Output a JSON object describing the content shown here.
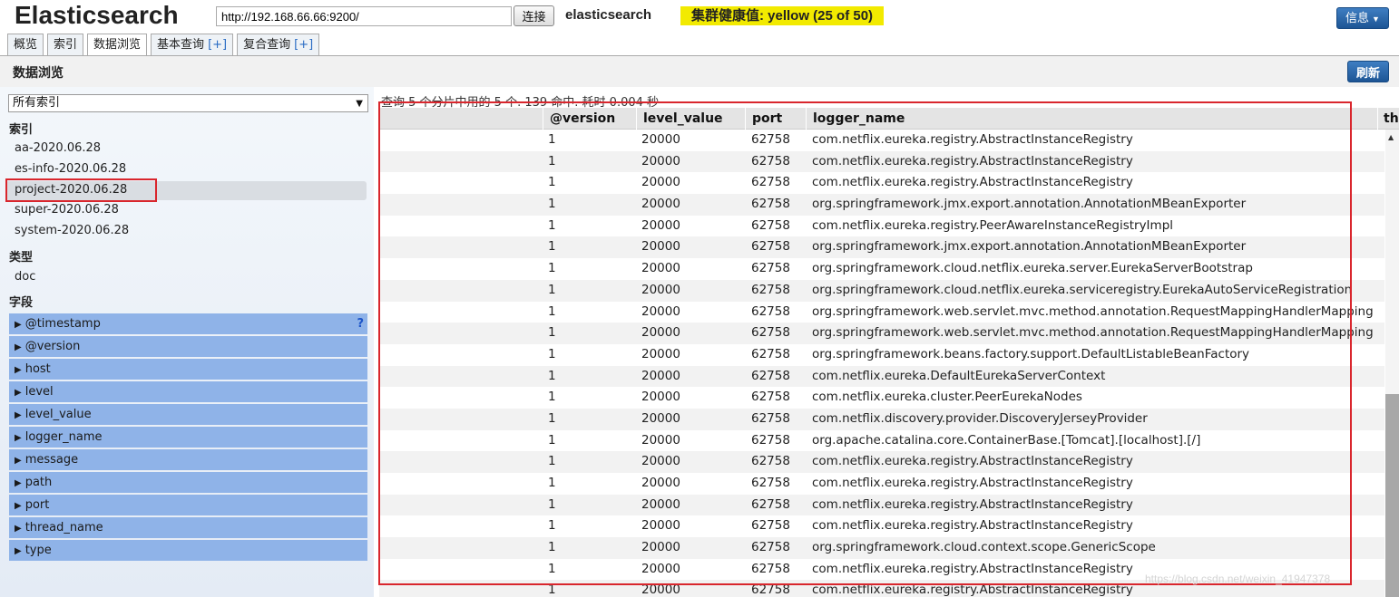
{
  "header": {
    "app_title": "Elasticsearch",
    "url_value": "http://192.168.66.66:9200/",
    "connect_label": "连接",
    "cluster_name": "elasticsearch",
    "health_text": "集群健康值: yellow (25 of 50)",
    "info_label": "信息"
  },
  "tabs": [
    {
      "label": "概览",
      "plus": ""
    },
    {
      "label": "索引",
      "plus": ""
    },
    {
      "label": "数据浏览",
      "plus": ""
    },
    {
      "label": "基本查询",
      "plus": "[+]"
    },
    {
      "label": "复合查询",
      "plus": "[+]"
    }
  ],
  "active_tab": "数据浏览",
  "section": {
    "title": "数据浏览",
    "refresh_label": "刷新"
  },
  "sidebar": {
    "index_select": "所有索引",
    "index_heading": "索引",
    "indices": [
      "aa-2020.06.28",
      "es-info-2020.06.28",
      "project-2020.06.28",
      "super-2020.06.28",
      "system-2020.06.28"
    ],
    "selected_index": "project-2020.06.28",
    "type_heading": "类型",
    "types": [
      "doc"
    ],
    "field_heading": "字段",
    "fields": [
      "@timestamp",
      "@version",
      "host",
      "level",
      "level_value",
      "logger_name",
      "message",
      "path",
      "port",
      "thread_name",
      "type"
    ],
    "help_icon": "?"
  },
  "results": {
    "summary": "查询 5 个分片中用的 5 个. 139 命中. 耗时 0.004 秒",
    "columns": [
      "@version",
      "level_value",
      "port",
      "logger_name",
      "th"
    ],
    "rows": [
      [
        "1",
        "20000",
        "62758",
        "com.netflix.eureka.registry.AbstractInstanceRegistry"
      ],
      [
        "1",
        "20000",
        "62758",
        "com.netflix.eureka.registry.AbstractInstanceRegistry"
      ],
      [
        "1",
        "20000",
        "62758",
        "com.netflix.eureka.registry.AbstractInstanceRegistry"
      ],
      [
        "1",
        "20000",
        "62758",
        "org.springframework.jmx.export.annotation.AnnotationMBeanExporter"
      ],
      [
        "1",
        "20000",
        "62758",
        "com.netflix.eureka.registry.PeerAwareInstanceRegistryImpl"
      ],
      [
        "1",
        "20000",
        "62758",
        "org.springframework.jmx.export.annotation.AnnotationMBeanExporter"
      ],
      [
        "1",
        "20000",
        "62758",
        "org.springframework.cloud.netflix.eureka.server.EurekaServerBootstrap"
      ],
      [
        "1",
        "20000",
        "62758",
        "org.springframework.cloud.netflix.eureka.serviceregistry.EurekaAutoServiceRegistration"
      ],
      [
        "1",
        "20000",
        "62758",
        "org.springframework.web.servlet.mvc.method.annotation.RequestMappingHandlerMapping"
      ],
      [
        "1",
        "20000",
        "62758",
        "org.springframework.web.servlet.mvc.method.annotation.RequestMappingHandlerMapping"
      ],
      [
        "1",
        "20000",
        "62758",
        "org.springframework.beans.factory.support.DefaultListableBeanFactory"
      ],
      [
        "1",
        "20000",
        "62758",
        "com.netflix.eureka.DefaultEurekaServerContext"
      ],
      [
        "1",
        "20000",
        "62758",
        "com.netflix.eureka.cluster.PeerEurekaNodes"
      ],
      [
        "1",
        "20000",
        "62758",
        "com.netflix.discovery.provider.DiscoveryJerseyProvider"
      ],
      [
        "1",
        "20000",
        "62758",
        "org.apache.catalina.core.ContainerBase.[Tomcat].[localhost].[/]"
      ],
      [
        "1",
        "20000",
        "62758",
        "com.netflix.eureka.registry.AbstractInstanceRegistry"
      ],
      [
        "1",
        "20000",
        "62758",
        "com.netflix.eureka.registry.AbstractInstanceRegistry"
      ],
      [
        "1",
        "20000",
        "62758",
        "com.netflix.eureka.registry.AbstractInstanceRegistry"
      ],
      [
        "1",
        "20000",
        "62758",
        "com.netflix.eureka.registry.AbstractInstanceRegistry"
      ],
      [
        "1",
        "20000",
        "62758",
        "org.springframework.cloud.context.scope.GenericScope"
      ],
      [
        "1",
        "20000",
        "62758",
        "com.netflix.eureka.registry.AbstractInstanceRegistry"
      ],
      [
        "1",
        "20000",
        "62758",
        "com.netflix.eureka.registry.AbstractInstanceRegistry"
      ]
    ]
  },
  "watermark": "https://blog.csdn.net/weixin_41947378",
  "colors": {
    "health": "#f2ea00",
    "accent": "#1d5595",
    "highlight_outline": "#d9262d",
    "field_bg": "#8fb3e8"
  }
}
